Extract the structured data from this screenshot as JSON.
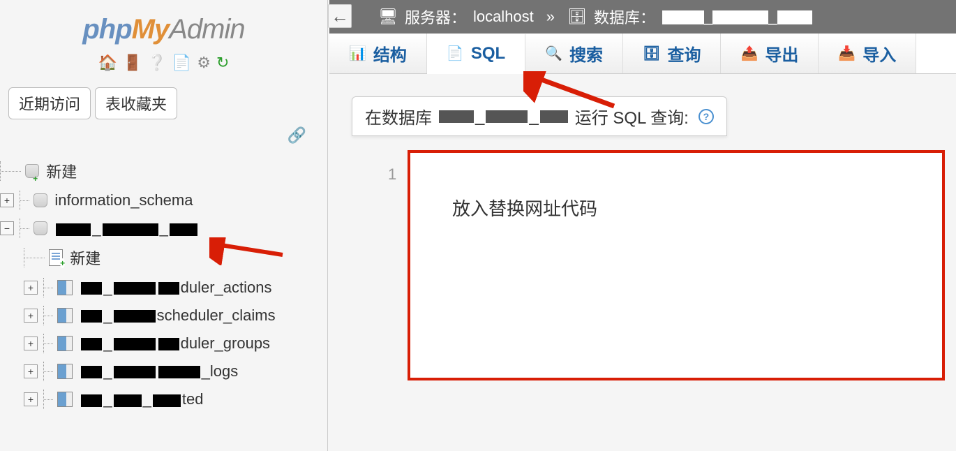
{
  "logo": {
    "php": "php",
    "my": "My",
    "admin": "Admin"
  },
  "sidebar": {
    "tabs": {
      "recent": "近期访问",
      "favorites": "表收藏夹"
    },
    "tree": {
      "new": "新建",
      "db1": "information_schema",
      "db2_redacted": "████_███████_████",
      "db2_new": "新建",
      "tables": {
        "t1_suffix": "duler_actions",
        "t2_suffix": "scheduler_claims",
        "t3_suffix": "duler_groups",
        "t4_suffix": "_logs",
        "t5_suffix": "ted"
      }
    }
  },
  "breadcrumb": {
    "server_label": "服务器：",
    "server_value": "localhost",
    "separator": "»",
    "db_label": "数据库：",
    "db_value_redacted": "████_███████_███"
  },
  "main_tabs": [
    {
      "label": "结构",
      "icon": "📊"
    },
    {
      "label": "SQL",
      "icon": "📄"
    },
    {
      "label": "搜索",
      "icon": "🔍"
    },
    {
      "label": "查询",
      "icon": "🗄"
    },
    {
      "label": "导出",
      "icon": "📤"
    },
    {
      "label": "导入",
      "icon": "📥"
    }
  ],
  "panel": {
    "prefix": "在数据库",
    "suffix": "运行 SQL 查询:"
  },
  "editor": {
    "line_number": "1",
    "placeholder": "放入替换网址代码"
  }
}
